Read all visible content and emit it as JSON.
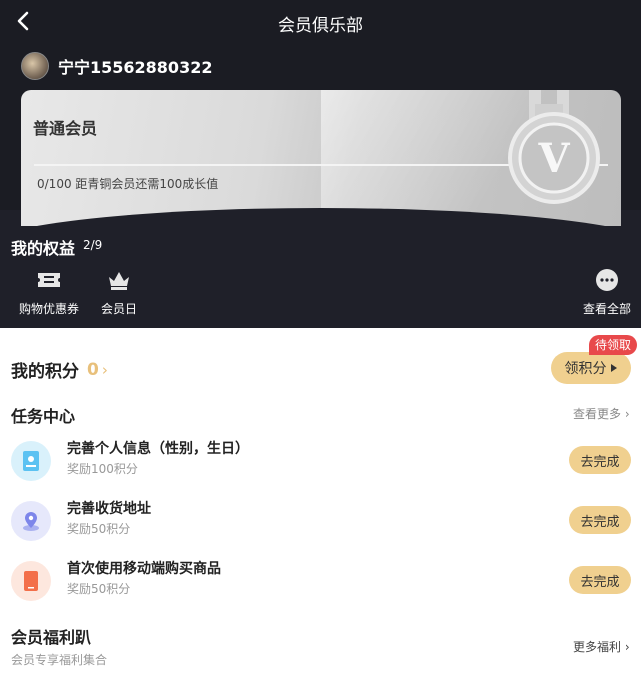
{
  "nav": {
    "title": "会员俱乐部",
    "back_icon": "chevron-left-icon"
  },
  "user": {
    "name": "宁宁15562880322"
  },
  "card": {
    "level": "普通会员",
    "progress_text": "0/100  距青铜会员还需100成长值",
    "medal_letter": "V"
  },
  "benefits": {
    "title": "我的权益",
    "count": "2/9",
    "items": [
      {
        "label": "购物优惠券",
        "icon": "ticket-icon"
      },
      {
        "label": "会员日",
        "icon": "crown-icon"
      }
    ],
    "view_all": "查看全部",
    "view_all_icon": "more-dots-icon"
  },
  "points": {
    "label": "我的积分",
    "value": "0",
    "arrow": "›",
    "claim_button": "领积分",
    "badge": "待领取"
  },
  "tasks": {
    "title": "任务中心",
    "more": "查看更多 ›",
    "items": [
      {
        "title": "完善个人信息（性别，生日）",
        "reward": "奖励100积分",
        "button": "去完成",
        "icon": "id-card-icon",
        "color": "#d9f1fb"
      },
      {
        "title": "完善收货地址",
        "reward": "奖励50积分",
        "button": "去完成",
        "icon": "location-pin-icon",
        "color": "#e6e8fb"
      },
      {
        "title": "首次使用移动端购买商品",
        "reward": "奖励50积分",
        "button": "去完成",
        "icon": "mobile-phone-icon",
        "color": "#fde7de"
      }
    ]
  },
  "welfare": {
    "title": "会员福利趴",
    "subtitle": "会员专享福利集合",
    "more": "更多福利 ›"
  }
}
